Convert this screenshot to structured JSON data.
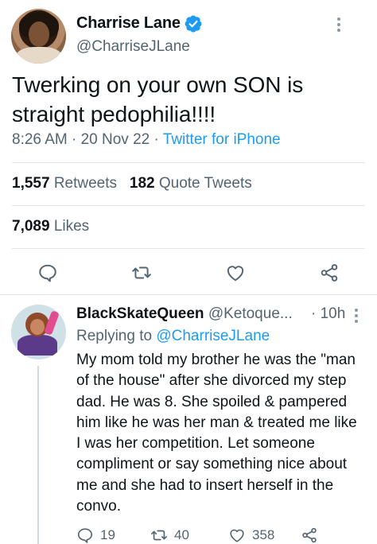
{
  "tweet": {
    "author": {
      "name": "Charrise Lane",
      "handle": "@CharriseJLane",
      "verified": true
    },
    "text": "Twerking on your own SON is straight pedophilia!!!!",
    "time": "8:26 AM",
    "separator": "·",
    "date": "20 Nov 22",
    "source": "Twitter for iPhone",
    "stats": {
      "retweets_count": "1,557",
      "retweets_label": "Retweets",
      "quote_count": "182",
      "quote_label": "Quote Tweets",
      "likes_count": "7,089",
      "likes_label": "Likes"
    },
    "actions": [
      "reply-icon",
      "retweet-icon",
      "like-icon",
      "share-icon"
    ]
  },
  "reply": {
    "author": {
      "name": "BlackSkateQueen",
      "handle": "@Ketoque..."
    },
    "time_sep": "·",
    "time": "10h",
    "replying_prefix": "Replying to",
    "replying_to": "@CharriseJLane",
    "text": "My mom told my brother he was the \"man of the house\" after she divorced my step dad. He was 8. She spoiled & pampered him like he was her man & treated me like I was her competition. Let someone compliment or say something nice about me and she had to insert herself in the convo.",
    "counts": {
      "replies": "19",
      "retweets": "40",
      "likes": "358"
    }
  },
  "colors": {
    "accent": "#1d9bf0",
    "text": "#0f1419",
    "secondary": "#536471",
    "divider": "#e3e7ea"
  }
}
